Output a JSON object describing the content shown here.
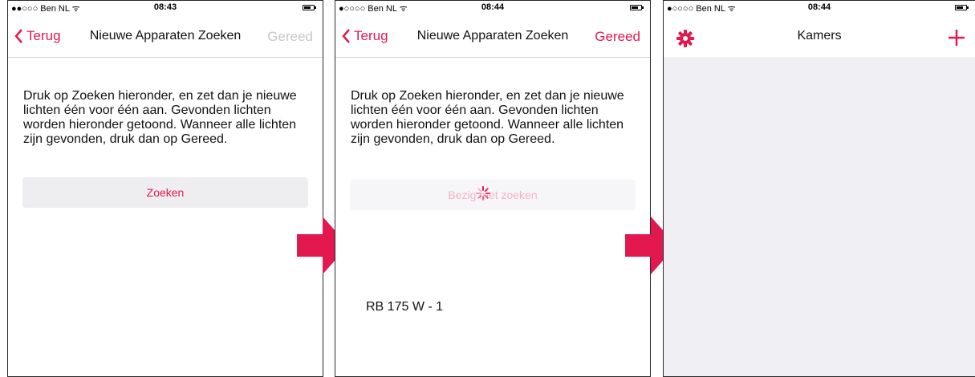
{
  "screens": [
    {
      "status": {
        "carrier": "●●○○○ Ben NL ᯤ",
        "time": "08:43"
      },
      "nav": {
        "back": "Terug",
        "title": "Nieuwe Apparaten Zoeken",
        "done": "Gereed"
      },
      "description": "Druk op Zoeken hieronder, en zet dan je nieuwe lichten één voor één aan. Gevonden lichten worden hieronder getoond. Wanneer alle lichten zijn gevonden, druk dan op Gereed.",
      "button": "Zoeken"
    },
    {
      "status": {
        "carrier": "●○○○○ Ben NL ᯤ",
        "time": "08:44"
      },
      "nav": {
        "back": "Terug",
        "title": "Nieuwe Apparaten Zoeken",
        "done": "Gereed"
      },
      "description": "Druk op Zoeken hieronder, en zet dan je nieuwe lichten één voor één aan. Gevonden lichten worden hieronder getoond. Wanneer alle lichten zijn gevonden, druk dan op Gereed.",
      "button": "Bezig met zoeken",
      "found": [
        "RB 175 W - 1"
      ]
    },
    {
      "status": {
        "carrier": "●○○○○ Ben NL ᯤ",
        "time": "08:44"
      },
      "nav": {
        "title": "Kamers"
      }
    }
  ],
  "icons": {
    "back": "chevron-left-icon",
    "settings": "gear-icon",
    "add": "plus-icon",
    "arrow": "arrow-right-icon"
  },
  "colors": {
    "accent": "#e2184e",
    "disabled": "#c7c7cc",
    "grey_background": "#efeff4"
  }
}
